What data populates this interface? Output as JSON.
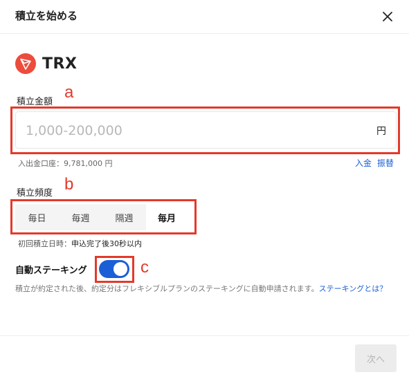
{
  "dialog": {
    "title": "積立を始める",
    "close_icon": "close-icon"
  },
  "coin": {
    "name": "TRX",
    "logo_icon": "tron-logo-icon",
    "logo_color": "#ec4c3c"
  },
  "amount": {
    "label": "積立金額",
    "placeholder": "1,000-200,000",
    "value": "",
    "unit": "円",
    "account_info": "入出金口座：9,781,000 円",
    "deposit_link": "入金",
    "transfer_link": "振替"
  },
  "frequency": {
    "label": "積立頻度",
    "options": [
      "毎日",
      "毎週",
      "隔週",
      "毎月"
    ],
    "selected": "毎月",
    "first_date_label": "初回積立日時：",
    "first_date_value": "申込完了後30秒以内"
  },
  "staking": {
    "label": "自動ステーキング",
    "enabled": true,
    "note": "積立が約定された後、約定分はフレキシブルプランのステーキングに自動申請されます。",
    "note_link": "ステーキングとは？"
  },
  "annotations": {
    "a": "a",
    "b": "b",
    "c": "c",
    "color": "#e3392a"
  },
  "footer": {
    "next_label": "次へ"
  },
  "colors": {
    "accent": "#1a5fd6",
    "disabled_bg": "#ececec",
    "disabled_text": "#b3b3b3"
  }
}
